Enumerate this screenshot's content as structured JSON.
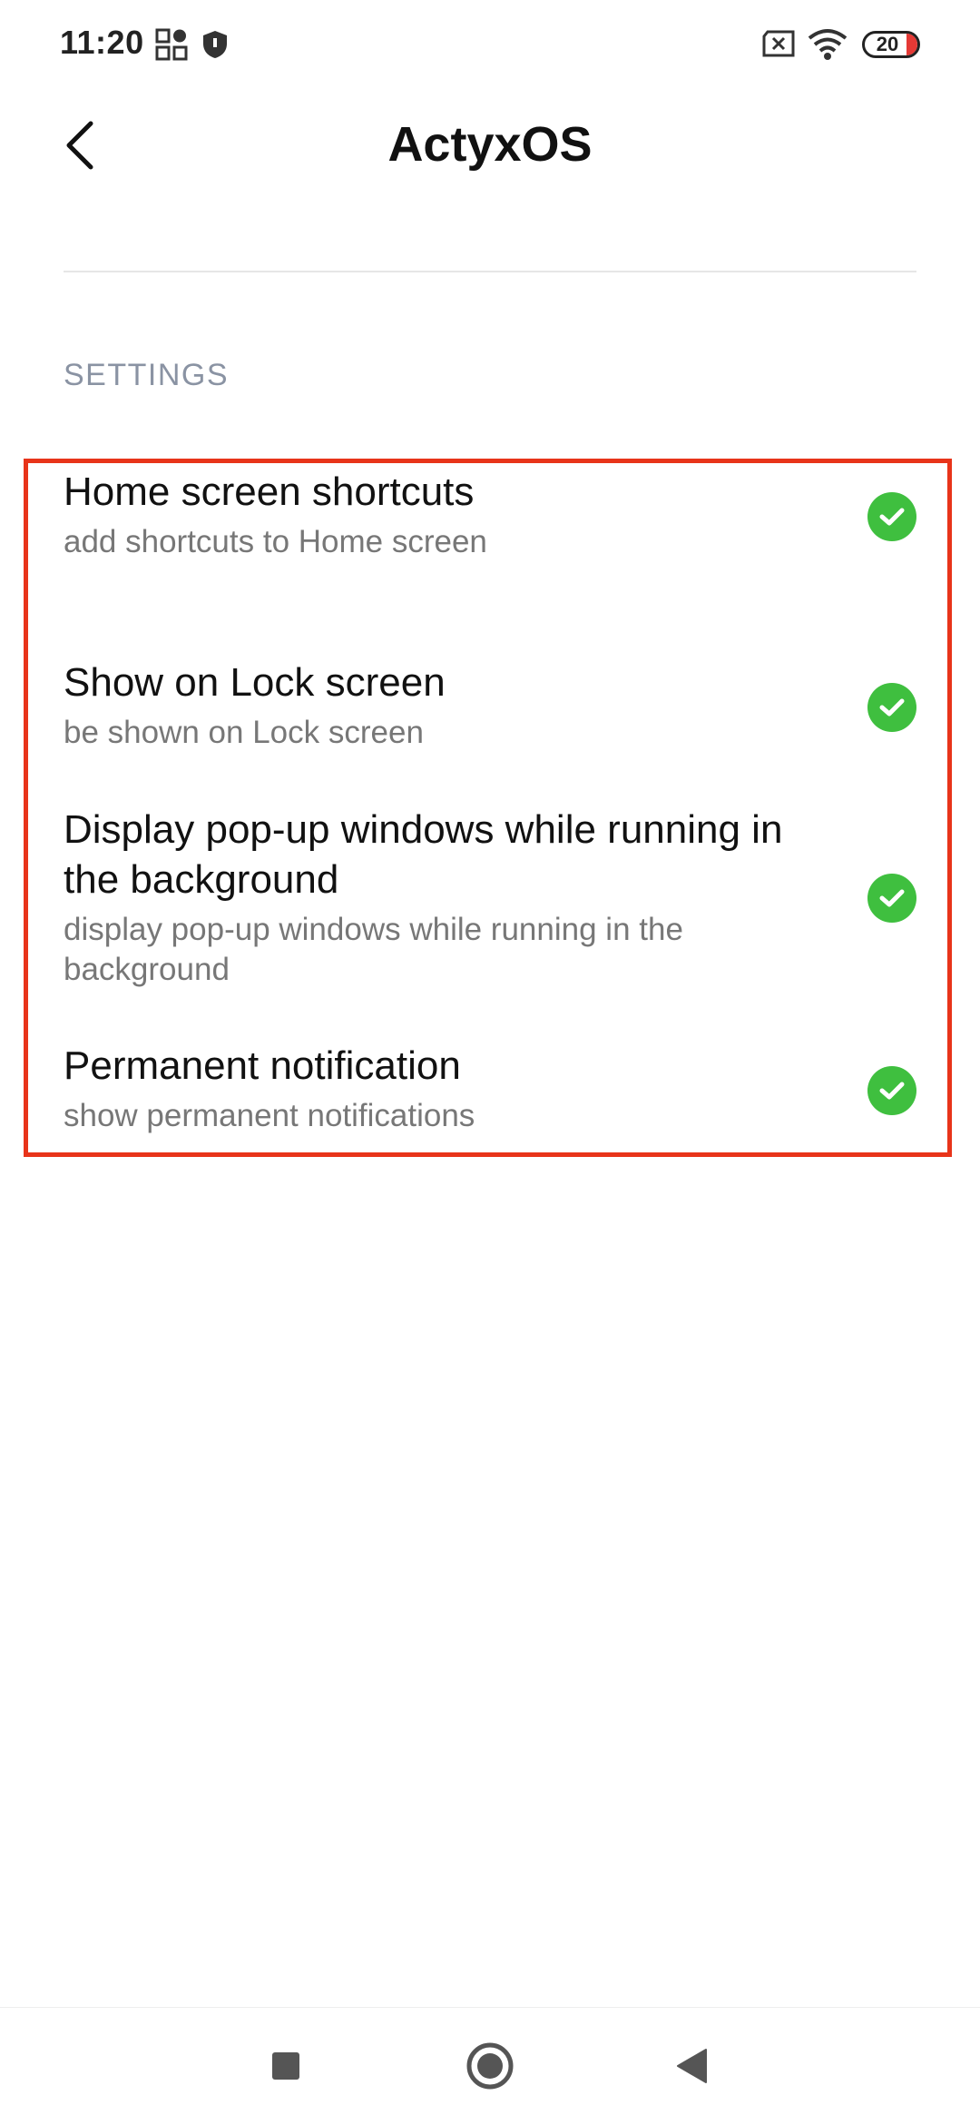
{
  "status_bar": {
    "time": "11:20",
    "icons": [
      "grid-apps-icon",
      "shield-icon",
      "no-sim-icon",
      "wifi-icon"
    ],
    "battery_level": "20",
    "battery_fill_fraction": 0.2
  },
  "header": {
    "title": "ActyxOS",
    "back_icon": "chevron-left-icon"
  },
  "section": {
    "label": "SETTINGS"
  },
  "settings": [
    {
      "title": "Home screen shortcuts",
      "subtitle": "add shortcuts to Home screen",
      "enabled": true
    },
    {
      "title": "Show on Lock screen",
      "subtitle": "be shown on Lock screen",
      "enabled": true
    },
    {
      "title": "Display pop-up windows while running in the background",
      "subtitle": "display pop-up windows while running in the background",
      "enabled": true
    },
    {
      "title": "Permanent notification",
      "subtitle": "show permanent notifications",
      "enabled": true
    }
  ],
  "nav_bar": {
    "buttons": [
      "recents-square-icon",
      "home-circle-icon",
      "back-triangle-icon"
    ]
  },
  "colors": {
    "check_green": "#3fbf3f",
    "highlight_red": "#e8341a",
    "section_gray": "#8a93a3"
  }
}
